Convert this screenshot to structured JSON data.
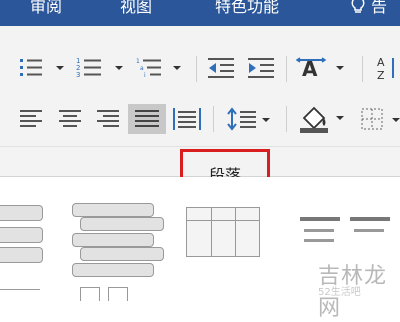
{
  "tabs": [
    {
      "label": "审阅"
    },
    {
      "label": "视图"
    },
    {
      "label": "特色功能"
    },
    {
      "label": "告"
    }
  ],
  "ribbon": {
    "group_label": "段落",
    "highlight_color": "#d81e1e",
    "tools": [
      {
        "icon": "bullet-list-icon"
      },
      {
        "icon": "numbered-list-icon"
      },
      {
        "icon": "multilevel-list-icon"
      },
      {
        "icon": "decrease-indent-icon"
      },
      {
        "icon": "increase-indent-icon"
      },
      {
        "icon": "chinese-layout-icon"
      },
      {
        "icon": "sort-icon"
      },
      {
        "icon": "align-left-icon"
      },
      {
        "icon": "align-center-icon"
      },
      {
        "icon": "align-right-icon"
      },
      {
        "icon": "justify-icon"
      },
      {
        "icon": "distributed-icon"
      },
      {
        "icon": "line-spacing-icon"
      },
      {
        "icon": "shading-icon"
      },
      {
        "icon": "borders-icon"
      }
    ]
  },
  "watermark": {
    "text": "吉林龙网",
    "sub": "52生活吧"
  },
  "colors": {
    "tab_bar": "#2b579a",
    "ribbon_bg": "#f3f3f3",
    "accent_blue": "#2f6fba"
  }
}
